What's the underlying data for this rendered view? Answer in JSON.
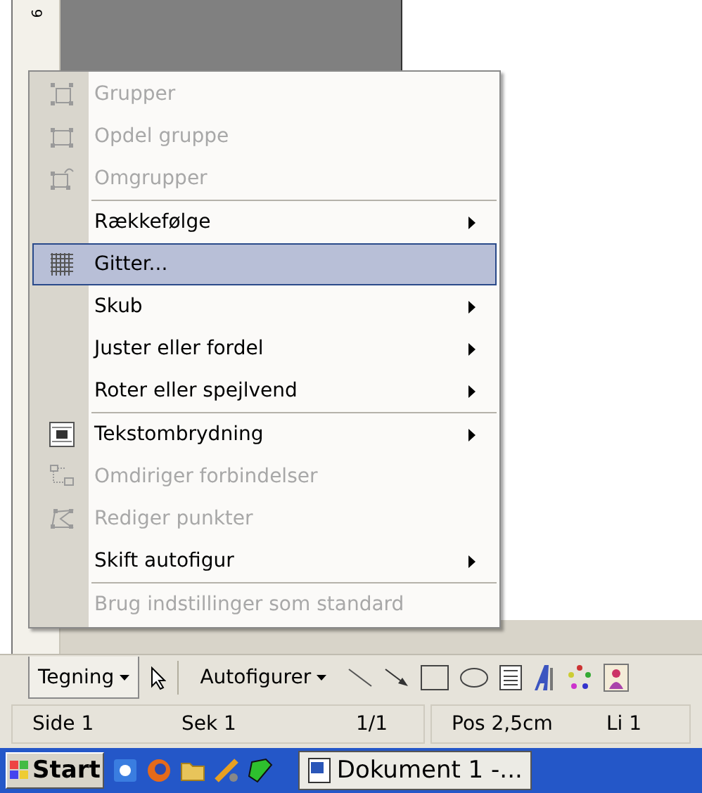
{
  "ruler": {
    "mark": "9"
  },
  "menu": {
    "items": [
      {
        "label": "Grupper",
        "kind": "group",
        "disabled": true,
        "submenu": false,
        "selected": false
      },
      {
        "label": "Opdel gruppe",
        "kind": "ungroup",
        "disabled": true,
        "submenu": false,
        "selected": false
      },
      {
        "label": "Omgrupper",
        "kind": "regroup",
        "disabled": true,
        "submenu": false,
        "selected": false,
        "separator_after": true
      },
      {
        "label": "Rækkefølge",
        "disabled": false,
        "submenu": true,
        "selected": false
      },
      {
        "label": "Gitter...",
        "kind": "grid",
        "disabled": false,
        "submenu": false,
        "selected": true
      },
      {
        "label": "Skub",
        "disabled": false,
        "submenu": true,
        "selected": false
      },
      {
        "label": "Juster eller fordel",
        "disabled": false,
        "submenu": true,
        "selected": false
      },
      {
        "label": "Roter eller spejlvend",
        "disabled": false,
        "submenu": true,
        "selected": false,
        "separator_after": true
      },
      {
        "label": "Tekstombrydning",
        "kind": "wrap",
        "disabled": false,
        "submenu": true,
        "selected": false
      },
      {
        "label": "Omdiriger forbindelser",
        "kind": "reroute",
        "disabled": true,
        "submenu": false,
        "selected": false
      },
      {
        "label": "Rediger punkter",
        "kind": "points",
        "disabled": true,
        "submenu": false,
        "selected": false
      },
      {
        "label": "Skift autofigur",
        "disabled": false,
        "submenu": true,
        "selected": false,
        "separator_after": true
      },
      {
        "label": "Brug indstillinger som standard",
        "disabled": true,
        "submenu": false,
        "selected": false
      }
    ]
  },
  "toolbar": {
    "draw_menu": {
      "label": "Tegning",
      "open": true
    },
    "autoshapes": {
      "label": "Autofigurer"
    }
  },
  "status_bar": {
    "panels": [
      {
        "fields": [
          "Side 1",
          "Sek 1",
          "1/1"
        ]
      },
      {
        "fields": [
          "Pos 2,5cm",
          "Li 1"
        ]
      }
    ]
  },
  "taskbar": {
    "start": "Start",
    "tasks": [
      {
        "label": "Dokument 1 -...",
        "selected": true
      }
    ]
  }
}
